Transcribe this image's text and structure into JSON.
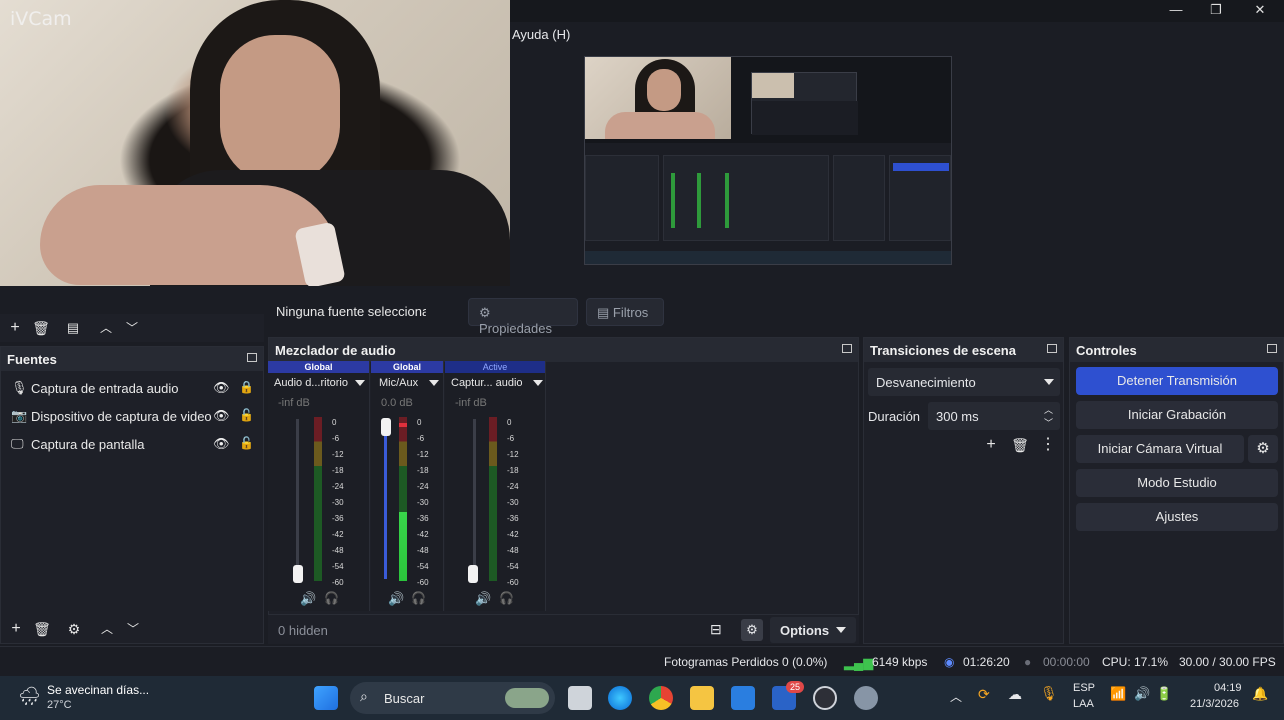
{
  "webcam": {
    "label": "iVCam"
  },
  "menu": {
    "help": "Ayuda (H)"
  },
  "window_controls": {
    "minimize": "—",
    "maximize": "❐",
    "close": "✕"
  },
  "props_bar": {
    "no_source": "Ninguna fuente seleccionad",
    "properties": "Propiedades",
    "filters": "Filtros"
  },
  "sources": {
    "title": "Fuentes",
    "items": [
      {
        "label": "Captura de entrada audio",
        "icon": "microphone-icon",
        "visible": true,
        "locked": true
      },
      {
        "label": "Dispositivo de captura de video",
        "icon": "camera-icon",
        "visible": true,
        "locked": false
      },
      {
        "label": "Captura de pantalla",
        "icon": "monitor-icon",
        "visible": true,
        "locked": false
      }
    ]
  },
  "mixer": {
    "title": "Mezclador de audio",
    "channels": [
      {
        "tag": "Global",
        "name": "Audio d...ritorio",
        "db": "-inf dB",
        "volume": 0.0,
        "level": 0.0
      },
      {
        "tag": "Global",
        "name": "Mic/Aux",
        "db": "0.0 dB",
        "volume": 1.0,
        "level": 0.42
      },
      {
        "tag": "Active",
        "name": "Captur... audio",
        "db": "-inf dB",
        "volume": 0.0,
        "level": 0.0
      }
    ],
    "ticks": [
      "0",
      "-6",
      "-12",
      "-18",
      "-24",
      "-30",
      "-36",
      "-42",
      "-48",
      "-54",
      "-60"
    ],
    "hidden": "0 hidden",
    "options": "Options"
  },
  "transitions": {
    "title": "Transiciones de escena",
    "selected": "Desvanecimiento",
    "duration_label": "Duración",
    "duration_value": "300 ms"
  },
  "controls": {
    "title": "Controles",
    "stop_stream": "Detener Transmisión",
    "start_recording": "Iniciar Grabación",
    "start_virtual_cam": "Iniciar Cámara Virtual",
    "studio_mode": "Modo Estudio",
    "settings": "Ajustes",
    "accent": "#2e50d0"
  },
  "status": {
    "dropped": "Fotogramas Perdidos 0 (0.0%)",
    "bitrate": "6149 kbps",
    "stream_time": "01:26:20",
    "rec_time": "00:00:00",
    "cpu": "CPU: 17.1%",
    "fps": "30.00 / 30.00 FPS"
  },
  "taskbar": {
    "weather_title": "Se avecinan días...",
    "weather_temp": "27°C",
    "search": "Buscar",
    "badge": "25",
    "lang_top": "ESP",
    "lang_bottom": "LAA",
    "time": "04:19",
    "date": "21/3/2026"
  }
}
